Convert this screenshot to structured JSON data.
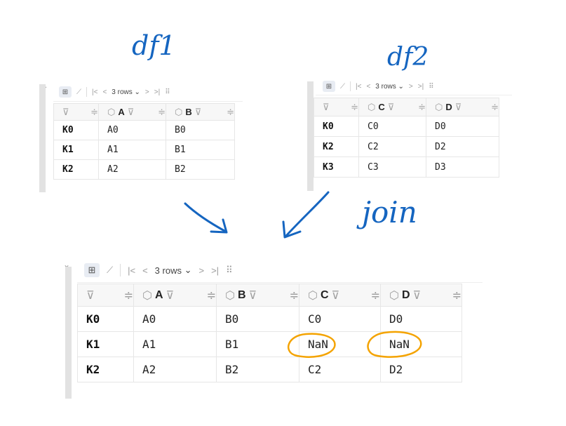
{
  "annotations": {
    "label_df1": "df1",
    "label_df2": "df2",
    "label_join": "join",
    "circle_color": "#f4a300",
    "ink_color": "#1565c0"
  },
  "toolbar": {
    "icons": {
      "table": "table-view-icon",
      "chart": "chart-view-icon",
      "first": "first-page-icon",
      "prev": "previous-page-icon",
      "next": "next-page-icon",
      "last": "last-page-icon",
      "grid": "column-settings-icon"
    },
    "glyphs": {
      "table": "⊞",
      "chart": "⟋",
      "first": "|<",
      "prev": "<",
      "next": ">",
      "last": ">|",
      "grid": "⠿",
      "chevron": "⌄",
      "collapse": "⌄",
      "filter": "⊽",
      "sort": "≑",
      "cube": "⬡"
    },
    "rows_label": "3 rows"
  },
  "df1": {
    "columns": [
      "A",
      "B"
    ],
    "rows": [
      {
        "index": "K0",
        "cells": [
          "A0",
          "B0"
        ]
      },
      {
        "index": "K1",
        "cells": [
          "A1",
          "B1"
        ]
      },
      {
        "index": "K2",
        "cells": [
          "A2",
          "B2"
        ]
      }
    ]
  },
  "df2": {
    "columns": [
      "C",
      "D"
    ],
    "rows": [
      {
        "index": "K0",
        "cells": [
          "C0",
          "D0"
        ]
      },
      {
        "index": "K2",
        "cells": [
          "C2",
          "D2"
        ]
      },
      {
        "index": "K3",
        "cells": [
          "C3",
          "D3"
        ]
      }
    ]
  },
  "result": {
    "columns": [
      "A",
      "B",
      "C",
      "D"
    ],
    "rows": [
      {
        "index": "K0",
        "cells": [
          "A0",
          "B0",
          "C0",
          "D0"
        ]
      },
      {
        "index": "K1",
        "cells": [
          "A1",
          "B1",
          "NaN",
          "NaN"
        ]
      },
      {
        "index": "K2",
        "cells": [
          "A2",
          "B2",
          "C2",
          "D2"
        ]
      }
    ]
  }
}
